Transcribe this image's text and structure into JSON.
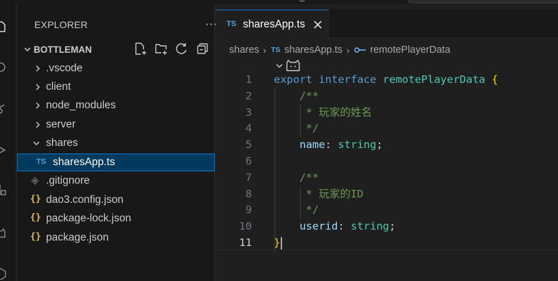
{
  "explorer": {
    "title": "EXPLORER",
    "more": "···",
    "folder_name": "BOTTLEMAN",
    "tree": [
      {
        "label": ".vscode",
        "kind": "folder",
        "expanded": false
      },
      {
        "label": "client",
        "kind": "folder",
        "expanded": false
      },
      {
        "label": "node_modules",
        "kind": "folder",
        "expanded": false
      },
      {
        "label": "server",
        "kind": "folder",
        "expanded": false
      },
      {
        "label": "shares",
        "kind": "folder",
        "expanded": true
      },
      {
        "label": "sharesApp.ts",
        "kind": "ts-file",
        "selected": true
      },
      {
        "label": ".gitignore",
        "kind": "git-file"
      },
      {
        "label": "dao3.config.json",
        "kind": "json-file"
      },
      {
        "label": "package-lock.json",
        "kind": "json-file"
      },
      {
        "label": "package.json",
        "kind": "json-file"
      }
    ],
    "file_badges": {
      "ts": "TS",
      "json": "{}"
    }
  },
  "editor": {
    "tab": {
      "badge": "TS",
      "label": "sharesApp.ts",
      "close_icon": "close-icon"
    },
    "breadcrumb": {
      "folder": "shares",
      "file_badge": "TS",
      "file": "sharesApp.ts",
      "symbol": "remotePlayerData"
    },
    "lines": [
      {
        "n": "1",
        "tokens": [
          {
            "t": "export",
            "c": "kw"
          },
          {
            "t": " ",
            "c": "pu"
          },
          {
            "t": "interface",
            "c": "kw"
          },
          {
            "t": " ",
            "c": "pu"
          },
          {
            "t": "remotePlayerData",
            "c": "ty"
          },
          {
            "t": " ",
            "c": "pu"
          },
          {
            "t": "{",
            "c": "br"
          }
        ]
      },
      {
        "n": "2",
        "tokens": [
          {
            "t": "    ",
            "c": "pu"
          },
          {
            "t": "/**",
            "c": "cm"
          }
        ]
      },
      {
        "n": "3",
        "tokens": [
          {
            "t": "     ",
            "c": "pu"
          },
          {
            "t": "* 玩家的姓名",
            "c": "cm"
          }
        ]
      },
      {
        "n": "4",
        "tokens": [
          {
            "t": "     ",
            "c": "pu"
          },
          {
            "t": "*/",
            "c": "cm"
          }
        ]
      },
      {
        "n": "5",
        "tokens": [
          {
            "t": "    ",
            "c": "pu"
          },
          {
            "t": "name",
            "c": "pr"
          },
          {
            "t": ": ",
            "c": "pu"
          },
          {
            "t": "string",
            "c": "ty"
          },
          {
            "t": ";",
            "c": "pu"
          }
        ]
      },
      {
        "n": "6",
        "tokens": []
      },
      {
        "n": "7",
        "tokens": [
          {
            "t": "    ",
            "c": "pu"
          },
          {
            "t": "/**",
            "c": "cm"
          }
        ]
      },
      {
        "n": "8",
        "tokens": [
          {
            "t": "     ",
            "c": "pu"
          },
          {
            "t": "* 玩家的ID",
            "c": "cm"
          }
        ]
      },
      {
        "n": "9",
        "tokens": [
          {
            "t": "     ",
            "c": "pu"
          },
          {
            "t": "*/",
            "c": "cm"
          }
        ]
      },
      {
        "n": "10",
        "tokens": [
          {
            "t": "    ",
            "c": "pu"
          },
          {
            "t": "userid",
            "c": "pr"
          },
          {
            "t": ": ",
            "c": "pu"
          },
          {
            "t": "string",
            "c": "ty"
          },
          {
            "t": ";",
            "c": "pu"
          }
        ]
      },
      {
        "n": "11",
        "tokens": [
          {
            "t": "}",
            "c": "br"
          }
        ],
        "active": true
      }
    ]
  },
  "colors": {
    "accent": "#0078d4",
    "selection": "#04395e",
    "keyword": "#569cd6",
    "type": "#4ec9b0",
    "property": "#9cdcfe",
    "comment": "#6a9955",
    "bracket": "#ffd700",
    "ts_badge": "#4fa6e0",
    "json_badge": "#e2c04b"
  }
}
